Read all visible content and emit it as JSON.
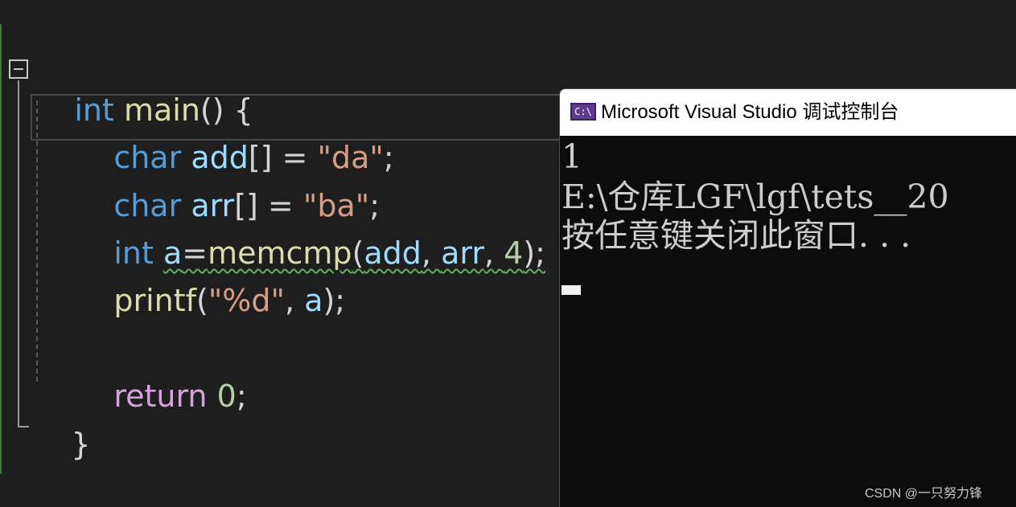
{
  "editor": {
    "lines": [
      {
        "tokens": [
          "int",
          " ",
          "main",
          "() {"
        ]
      },
      {
        "tokens": [
          "char",
          " ",
          "add",
          "[] = ",
          "\"da\"",
          ";"
        ]
      },
      {
        "tokens": [
          "char",
          " ",
          "arr",
          "[] = ",
          "\"ba\"",
          ";"
        ]
      },
      {
        "tokens": [
          "int",
          " ",
          "a",
          "=",
          "memcmp",
          "(",
          "add",
          ", ",
          "arr",
          ", ",
          "4",
          ");"
        ]
      },
      {
        "tokens": [
          "printf",
          "(",
          "\"%d\"",
          ", ",
          "a",
          ");"
        ]
      },
      {
        "tokens": [
          "return",
          " ",
          "0",
          ";"
        ]
      },
      {
        "tokens": [
          "}"
        ]
      }
    ]
  },
  "console": {
    "title": "Microsoft Visual Studio 调试控制台",
    "icon": "C:\\",
    "icon_name": "console-app-icon",
    "output_lines": [
      "1",
      "E:\\仓库LGF\\lgf\\tets__20",
      "按任意键关闭此窗口. . ."
    ]
  },
  "watermark": "CSDN @一只努力锋",
  "colors": {
    "keyword": "#569cd6",
    "function": "#dcdcaa",
    "variable": "#9cdcfe",
    "string": "#d69d85",
    "number": "#b5cea8",
    "control": "#d8a0df",
    "editor_bg": "#1e1e1e",
    "console_bg": "#0c0c0c"
  }
}
